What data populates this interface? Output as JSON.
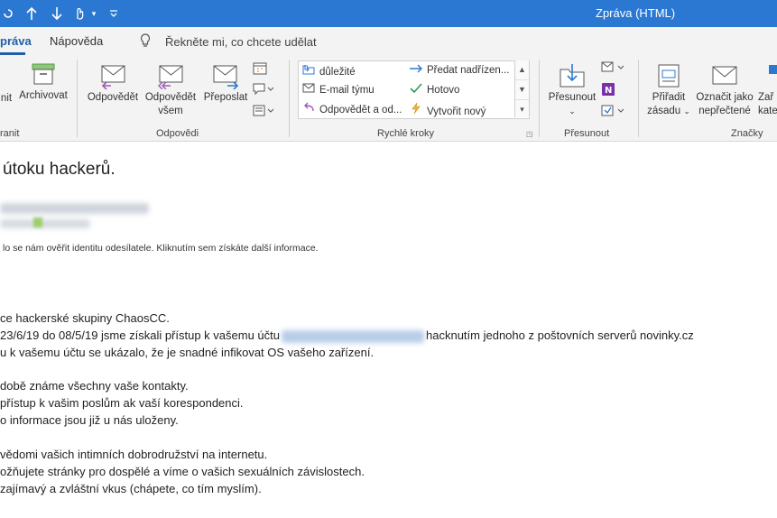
{
  "window": {
    "title": "Zpráva (HTML)"
  },
  "quick_access": {
    "up_icon": "arrow-up-icon",
    "down_icon": "arrow-down-icon",
    "touch_icon": "touch-mode-icon",
    "customize_icon": "customize-qat-icon"
  },
  "tabs": [
    {
      "label": "práva",
      "active": true
    },
    {
      "label": "Nápověda",
      "active": false
    }
  ],
  "tell_me": {
    "placeholder": "Řekněte mi, co chcete udělat"
  },
  "ribbon": {
    "delete_group": {
      "ignore_label": "nit",
      "archive_label": "Archivovat",
      "group_label": "ranit"
    },
    "respond_group": {
      "reply_label": "Odpovědět",
      "reply_all_line1": "Odpovědět",
      "reply_all_line2": "všem",
      "forward_label": "Přeposlat",
      "group_label": "Odpovědi"
    },
    "quick_steps": {
      "items": [
        {
          "label": "důležité",
          "icon": "folder-arrow-icon"
        },
        {
          "label": "Předat nadřízen...",
          "icon": "forward-arrow-icon"
        },
        {
          "label": "E-mail týmu",
          "icon": "envelope-icon"
        },
        {
          "label": "Hotovo",
          "icon": "check-icon"
        },
        {
          "label": "Odpovědět a od...",
          "icon": "reply-delete-icon"
        },
        {
          "label": "Vytvořit nový",
          "icon": "lightning-icon"
        }
      ],
      "group_label": "Rychlé kroky"
    },
    "move_group": {
      "move_label": "Přesunout",
      "group_label": "Přesunout"
    },
    "tags_group": {
      "assign_policy_line1": "Přiřadit",
      "assign_policy_line2": "zásadu",
      "mark_unread_line1": "Označit jako",
      "mark_unread_line2": "nepřečtené",
      "categorize_line1": "Zař",
      "categorize_line2": "kate",
      "group_label": "Značky"
    }
  },
  "message": {
    "subject": "útoku hackerů.",
    "security_warning": "lo se nám ověřit identitu odesílatele. Kliknutím sem získáte další informace.",
    "body": {
      "line1": "ce hackerské skupiny ChaosCC.",
      "line2_part1": " 23/6/19 do 08/5/19 jsme získali přístup k vašemu účtu",
      "line2_part2": "hacknutím jednoho z poštovních serverů novinky.cz",
      "line3": "u k vašemu účtu se ukázalo, že je snadné infikovat OS vašeho zařízení.",
      "line4": "době známe všechny vaše kontakty.",
      "line5": "přístup k vašim poslům ak vaší korespondenci.",
      "line6": "o informace jsou již u nás uloženy.",
      "line7": " vědomi vašich intimních dobrodružství na internetu.",
      "line8": "ožňujete stránky pro dospělé a víme o vašich sexuálních závislostech.",
      "line9": "zajímavý a zvláštní vkus (chápete, co tím myslím)."
    }
  }
}
